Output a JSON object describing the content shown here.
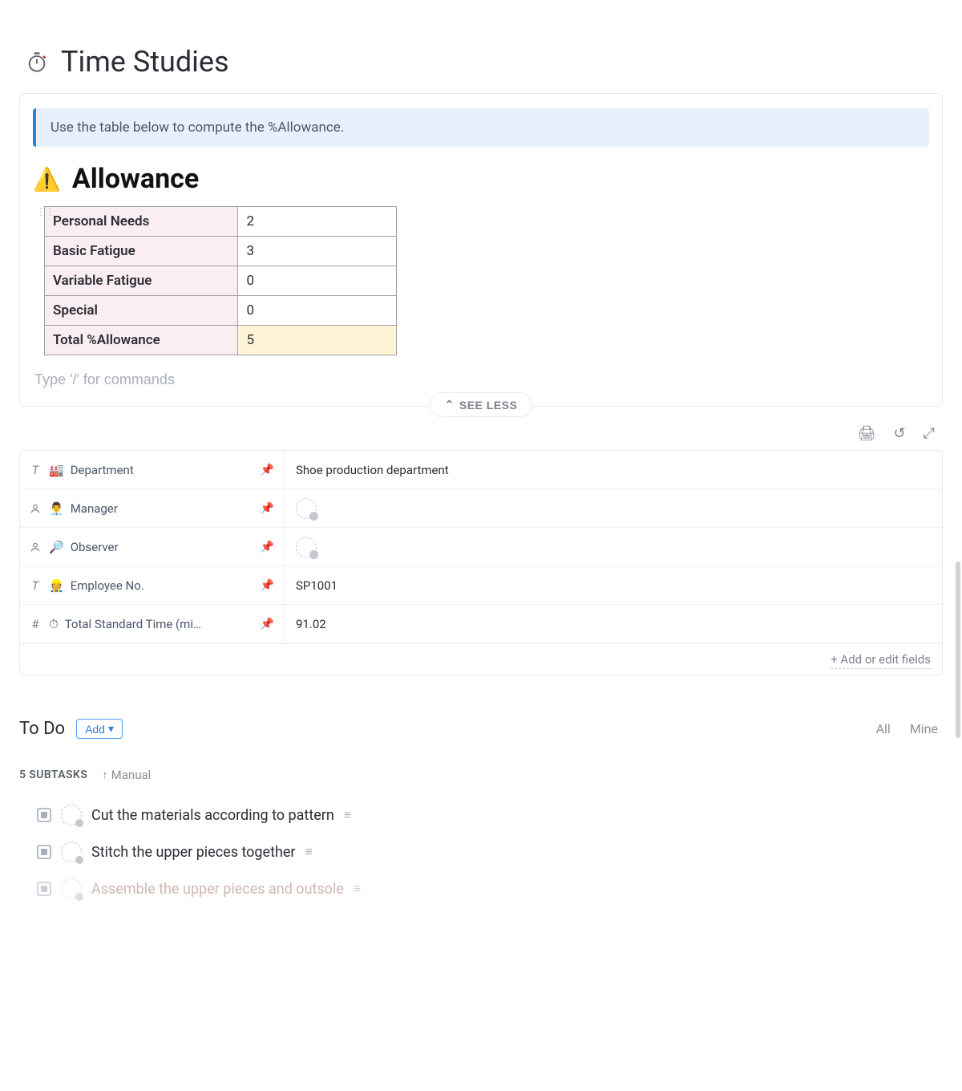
{
  "title": "Time Studies",
  "callout": "Use the table below to compute the %Allowance.",
  "allowance": {
    "heading": "Allowance",
    "rows": [
      {
        "label": "Personal Needs",
        "value": "2"
      },
      {
        "label": "Basic Fatigue",
        "value": "3"
      },
      {
        "label": "Variable Fatigue",
        "value": "0"
      },
      {
        "label": "Special",
        "value": "0"
      }
    ],
    "total_label": "Total %Allowance",
    "total_value": "5"
  },
  "slash_placeholder": "Type '/' for commands",
  "see_less": "SEE LESS",
  "fields": [
    {
      "type": "T",
      "emoji": "🏭",
      "name": "Department",
      "value_text": "Shoe production department",
      "value_kind": "text"
    },
    {
      "type": "person",
      "emoji": "👨‍💼",
      "name": "Manager",
      "value_kind": "assignee"
    },
    {
      "type": "person",
      "emoji": "🔎",
      "name": "Observer",
      "value_kind": "assignee"
    },
    {
      "type": "T",
      "emoji": "👷",
      "name": "Employee No.",
      "value_text": "SP1001",
      "value_kind": "text"
    },
    {
      "type": "#",
      "emoji": "⏱",
      "name": "Total Standard Time (mi…",
      "value_text": "91.02",
      "value_kind": "text"
    }
  ],
  "add_fields_label": "+ Add or edit fields",
  "todo": {
    "title": "To Do",
    "add_label": "Add",
    "filters": {
      "all": "All",
      "mine": "Mine"
    },
    "count_label": "5 SUBTASKS",
    "sort_label": "Manual",
    "items": [
      {
        "title": "Cut the materials according to pattern"
      },
      {
        "title": "Stitch the upper pieces together"
      },
      {
        "title": "Assemble the upper pieces and outsole"
      }
    ]
  }
}
